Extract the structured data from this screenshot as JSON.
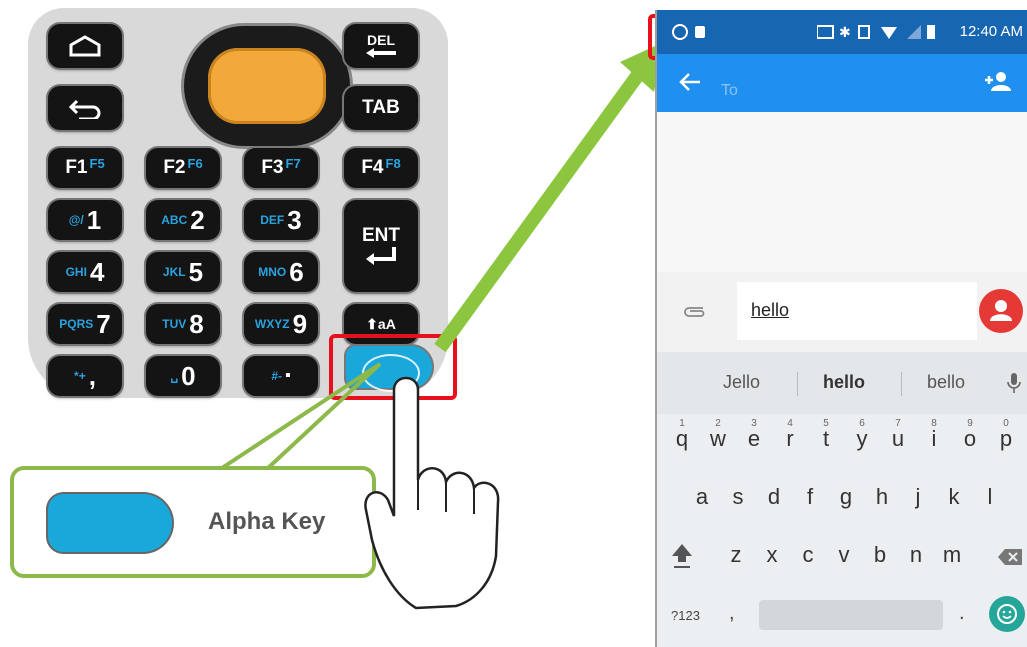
{
  "keypad": {
    "del_label": "DEL",
    "tab_label": "TAB",
    "ent_label": "ENT",
    "function_keys": [
      {
        "main": "F1",
        "alt": "F5"
      },
      {
        "main": "F2",
        "alt": "F6"
      },
      {
        "main": "F3",
        "alt": "F7"
      },
      {
        "main": "F4",
        "alt": "F8"
      }
    ],
    "number_keys": [
      {
        "sub": "@/",
        "main": "1"
      },
      {
        "sub": "ABC",
        "main": "2"
      },
      {
        "sub": "DEF",
        "main": "3"
      },
      {
        "sub": "GHI",
        "main": "4"
      },
      {
        "sub": "JKL",
        "main": "5"
      },
      {
        "sub": "MNO",
        "main": "6"
      },
      {
        "sub": "PQRS",
        "main": "7"
      },
      {
        "sub": "TUV",
        "main": "8"
      },
      {
        "sub": "WXYZ",
        "main": "9"
      },
      {
        "sub": "*+",
        "main": ","
      },
      {
        "sub": "␣",
        "main": "0"
      },
      {
        "sub": "#-",
        "main": "▪"
      }
    ],
    "shift_label": "⬆aA",
    "colors": {
      "alpha": "#1aa7d9",
      "scan": "#f2a93a",
      "highlight": "#e8101a",
      "arrow": "#8cc63f"
    }
  },
  "callout": {
    "label": "Alpha Key"
  },
  "phone": {
    "status_time": "12:40 AM",
    "to_placeholder": "To",
    "input_text": "hello",
    "suggestions": [
      "Jello",
      "hello",
      "bello"
    ],
    "row1": [
      "q",
      "w",
      "e",
      "r",
      "t",
      "y",
      "u",
      "i",
      "o",
      "p"
    ],
    "row1_nums": [
      "1",
      "2",
      "3",
      "4",
      "5",
      "6",
      "7",
      "8",
      "9",
      "0"
    ],
    "row2": [
      "a",
      "s",
      "d",
      "f",
      "g",
      "h",
      "j",
      "k",
      "l"
    ],
    "row3": [
      "z",
      "x",
      "c",
      "v",
      "b",
      "n",
      "m"
    ],
    "symbols_key": "?123",
    "comma_key": ",",
    "period_key": "."
  }
}
